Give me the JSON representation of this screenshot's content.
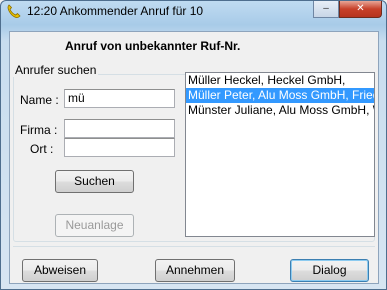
{
  "window": {
    "title": "12:20 Ankommender Anruf für 10",
    "minimize_glyph": "–",
    "close_glyph": "✕",
    "icon": "phone-icon"
  },
  "header": {
    "heading": "Anruf von unbekannter Ruf-Nr."
  },
  "search": {
    "group_label": "Anrufer suchen",
    "name_label": "Name :",
    "name_value": "mü",
    "firma_label": "Firma :",
    "firma_value": "",
    "ort_label": "Ort :",
    "ort_value": "",
    "search_button": "Suchen",
    "new_button": "Neuanlage"
  },
  "results": {
    "items": [
      "Müller Heckel, Heckel GmbH,",
      "Müller Peter, Alu Moss GmbH, Friedr",
      "Münster Juliane, Alu Moss GmbH, W"
    ],
    "selected_index": 1
  },
  "footer": {
    "reject_button": "Abweisen",
    "accept_button": "Annehmen",
    "dialog_button": "Dialog"
  },
  "colors": {
    "selection": "#3399ff",
    "title_bar": "#bfdbf1",
    "close_button": "#c7412a"
  }
}
